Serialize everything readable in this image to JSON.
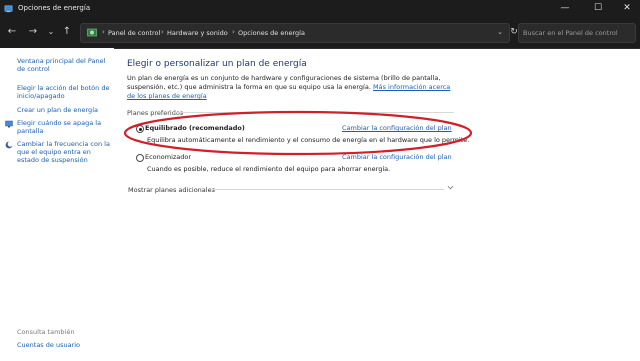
{
  "window": {
    "title": "Opciones de energía",
    "minimize": "—",
    "maximize": "☐",
    "close": "✕"
  },
  "nav": {
    "back": "←",
    "forward": "→",
    "recent": "⌄",
    "up": "↑",
    "refresh": "↻"
  },
  "address": {
    "crumbs": [
      "Panel de control",
      "Hardware y sonido",
      "Opciones de energía"
    ],
    "separator": "›",
    "dropdown": "⌄"
  },
  "search": {
    "placeholder": "Buscar en el Panel de control"
  },
  "sidebar": {
    "links": [
      {
        "label": "Ventana principal del Panel de control"
      },
      {
        "label": "Elegir la acción del botón de inicio/apagado"
      },
      {
        "label": "Crear un plan de energía"
      },
      {
        "label": "Elegir cuándo se apaga la pantalla",
        "icon": "monitor-shield-icon"
      },
      {
        "label": "Cambiar la frecuencia con la que el equipo entra en estado de suspensión",
        "icon": "moon-icon"
      }
    ],
    "see_also": "Consulta también",
    "user_accounts": "Cuentas de usuario"
  },
  "main": {
    "heading": "Elegir o personalizar un plan de energía",
    "intro": "Un plan de energía es un conjunto de hardware y configuraciones de sistema (brillo de pantalla, suspensión, etc.) que administra la forma en que su equipo usa la energía.",
    "intro_link": "Más información acerca de los planes de energía",
    "preferred_label": "Planes preferidos",
    "plans": [
      {
        "name": "Equilibrado (recomendado)",
        "selected": true,
        "description": "Equilibra automáticamente el rendimiento y el consumo de energía en el hardware que lo permite.",
        "link": "Cambiar la configuración del plan"
      },
      {
        "name": "Economizador",
        "selected": false,
        "description": "Cuando es posible, reduce el rendimiento del equipo para ahorrar energía.",
        "link": "Cambiar la configuración del plan"
      }
    ],
    "more_plans": "Mostrar planes adicionales"
  },
  "colors": {
    "link": "#1a5fb4",
    "heading": "#1e3a7a",
    "annotation": "#d0202a",
    "titlebar": "#1c1c1c"
  }
}
